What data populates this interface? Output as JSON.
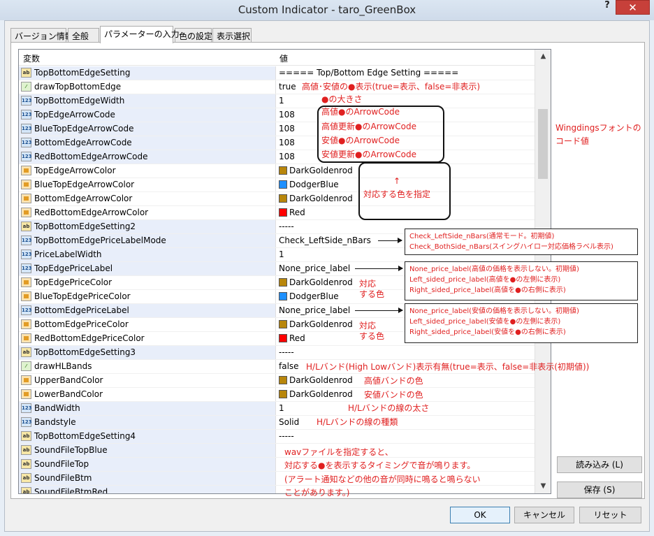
{
  "window": {
    "title": "Custom Indicator - taro_GreenBox",
    "help_label": "?",
    "close_label": "✕"
  },
  "tabs": [
    {
      "label": "バージョン情報"
    },
    {
      "label": "全般"
    },
    {
      "label": "パラメーターの入力"
    },
    {
      "label": "色の設定"
    },
    {
      "label": "表示選択"
    }
  ],
  "grid": {
    "col_variable": "変数",
    "col_value": "値",
    "rows": [
      {
        "type": "ab",
        "name": "TopBottomEdgeSetting",
        "value": "===== Top/Bottom Edge Setting ====="
      },
      {
        "type": "bool",
        "name": "drawTopBottomEdge",
        "value": "true"
      },
      {
        "type": "123",
        "name": "TopBottomEdgeWidth",
        "value": "1"
      },
      {
        "type": "123",
        "name": "TopEdgeArrowCode",
        "value": "108"
      },
      {
        "type": "123",
        "name": "BlueTopEdgeArrowCode",
        "value": "108"
      },
      {
        "type": "123",
        "name": "BottomEdgeArrowCode",
        "value": "108"
      },
      {
        "type": "123",
        "name": "RedBottomEdgeArrowCode",
        "value": "108"
      },
      {
        "type": "color",
        "name": "TopEdgeArrowColor",
        "value": "DarkGoldenrod",
        "swatch": "#b8860b"
      },
      {
        "type": "color",
        "name": "BlueTopEdgeArrowColor",
        "value": "DodgerBlue",
        "swatch": "#1e90ff"
      },
      {
        "type": "color",
        "name": "BottomEdgeArrowColor",
        "value": "DarkGoldenrod",
        "swatch": "#b8860b"
      },
      {
        "type": "color",
        "name": "RedBottomEdgeArrowColor",
        "value": "Red",
        "swatch": "#ff0000"
      },
      {
        "type": "ab",
        "name": "TopBottomEdgeSetting2",
        "value": "-----"
      },
      {
        "type": "123",
        "name": "TopBottomEdgePriceLabelMode",
        "value": "Check_LeftSide_nBars"
      },
      {
        "type": "123",
        "name": "PriceLabelWidth",
        "value": "1"
      },
      {
        "type": "123",
        "name": "TopEdgePriceLabel",
        "value": "None_price_label"
      },
      {
        "type": "color",
        "name": "TopEdgePriceColor",
        "value": "DarkGoldenrod",
        "swatch": "#b8860b"
      },
      {
        "type": "color",
        "name": "BlueTopEdgePriceColor",
        "value": "DodgerBlue",
        "swatch": "#1e90ff"
      },
      {
        "type": "123",
        "name": "BottomEdgePriceLabel",
        "value": "None_price_label"
      },
      {
        "type": "color",
        "name": "BottomEdgePriceColor",
        "value": "DarkGoldenrod",
        "swatch": "#b8860b"
      },
      {
        "type": "color",
        "name": "RedBottomEdgePriceColor",
        "value": "Red",
        "swatch": "#ff0000"
      },
      {
        "type": "ab",
        "name": "TopBottomEdgeSetting3",
        "value": "-----"
      },
      {
        "type": "bool",
        "name": "drawHLBands",
        "value": "false"
      },
      {
        "type": "color",
        "name": "UpperBandColor",
        "value": "DarkGoldenrod",
        "swatch": "#b8860b"
      },
      {
        "type": "color",
        "name": "LowerBandColor",
        "value": "DarkGoldenrod",
        "swatch": "#b8860b"
      },
      {
        "type": "123",
        "name": "BandWidth",
        "value": "1"
      },
      {
        "type": "123",
        "name": "Bandstyle",
        "value": "Solid"
      },
      {
        "type": "ab",
        "name": "TopBottomEdgeSetting4",
        "value": "-----"
      },
      {
        "type": "ab",
        "name": "SoundFileTopBlue",
        "value": ""
      },
      {
        "type": "ab",
        "name": "SoundFileTop",
        "value": ""
      },
      {
        "type": "ab",
        "name": "SoundFileBtm",
        "value": ""
      },
      {
        "type": "ab",
        "name": "SoundFileBtmRed",
        "value": ""
      }
    ]
  },
  "annotations": {
    "draw_edge": "高値･安値の●表示(true=表示、false=非表示)",
    "width": "●の大きさ",
    "code_top": "高値●のArrowCode",
    "code_blue_top": "高値更新●のArrowCode",
    "code_bottom": "安値●のArrowCode",
    "code_red_bottom": "安値更新●のArrowCode",
    "wingdings": "Wingdingsフォントの\nコード値",
    "color_up_arrow": "↑",
    "color_note": "対応する色を指定",
    "mode_options": "Check_LeftSide_nBars(通常モード。初期値)\nCheck_BothSide_nBars(スイングハイロー対応価格ラベル表示)",
    "top_label_options": "None_price_label(高値の価格を表示しない。初期値)\nLeft_sided_price_label(高値を●の左側に表示)\nRight_sided_price_label(高値を●の右側に表示)",
    "top_color_note": "対応\nする色",
    "bottom_label_options": "None_price_label(安値の価格を表示しない。初期値)\nLeft_sided_price_label(安値を●の左側に表示)\nRight_sided_price_label(安値を●の右側に表示)",
    "bottom_color_note": "対応\nする色",
    "hl_bands": "H/Lバンド(High Lowバンド)表示有無(true=表示、false=非表示(初期値))",
    "upper_band": "高値バンドの色",
    "lower_band": "安値バンドの色",
    "band_width": "H/Lバンドの線の太さ",
    "band_style": "H/Lバンドの線の種類",
    "sound": "wavファイルを指定すると、\n対応する●を表示するタイミングで音が鳴ります。\n(アラート通知などの他の音が同時に鳴ると鳴らない\nことがあります。)"
  },
  "buttons": {
    "load": "読み込み (L)",
    "save": "保存 (S)",
    "ok": "OK",
    "cancel": "キャンセル",
    "reset": "リセット"
  }
}
